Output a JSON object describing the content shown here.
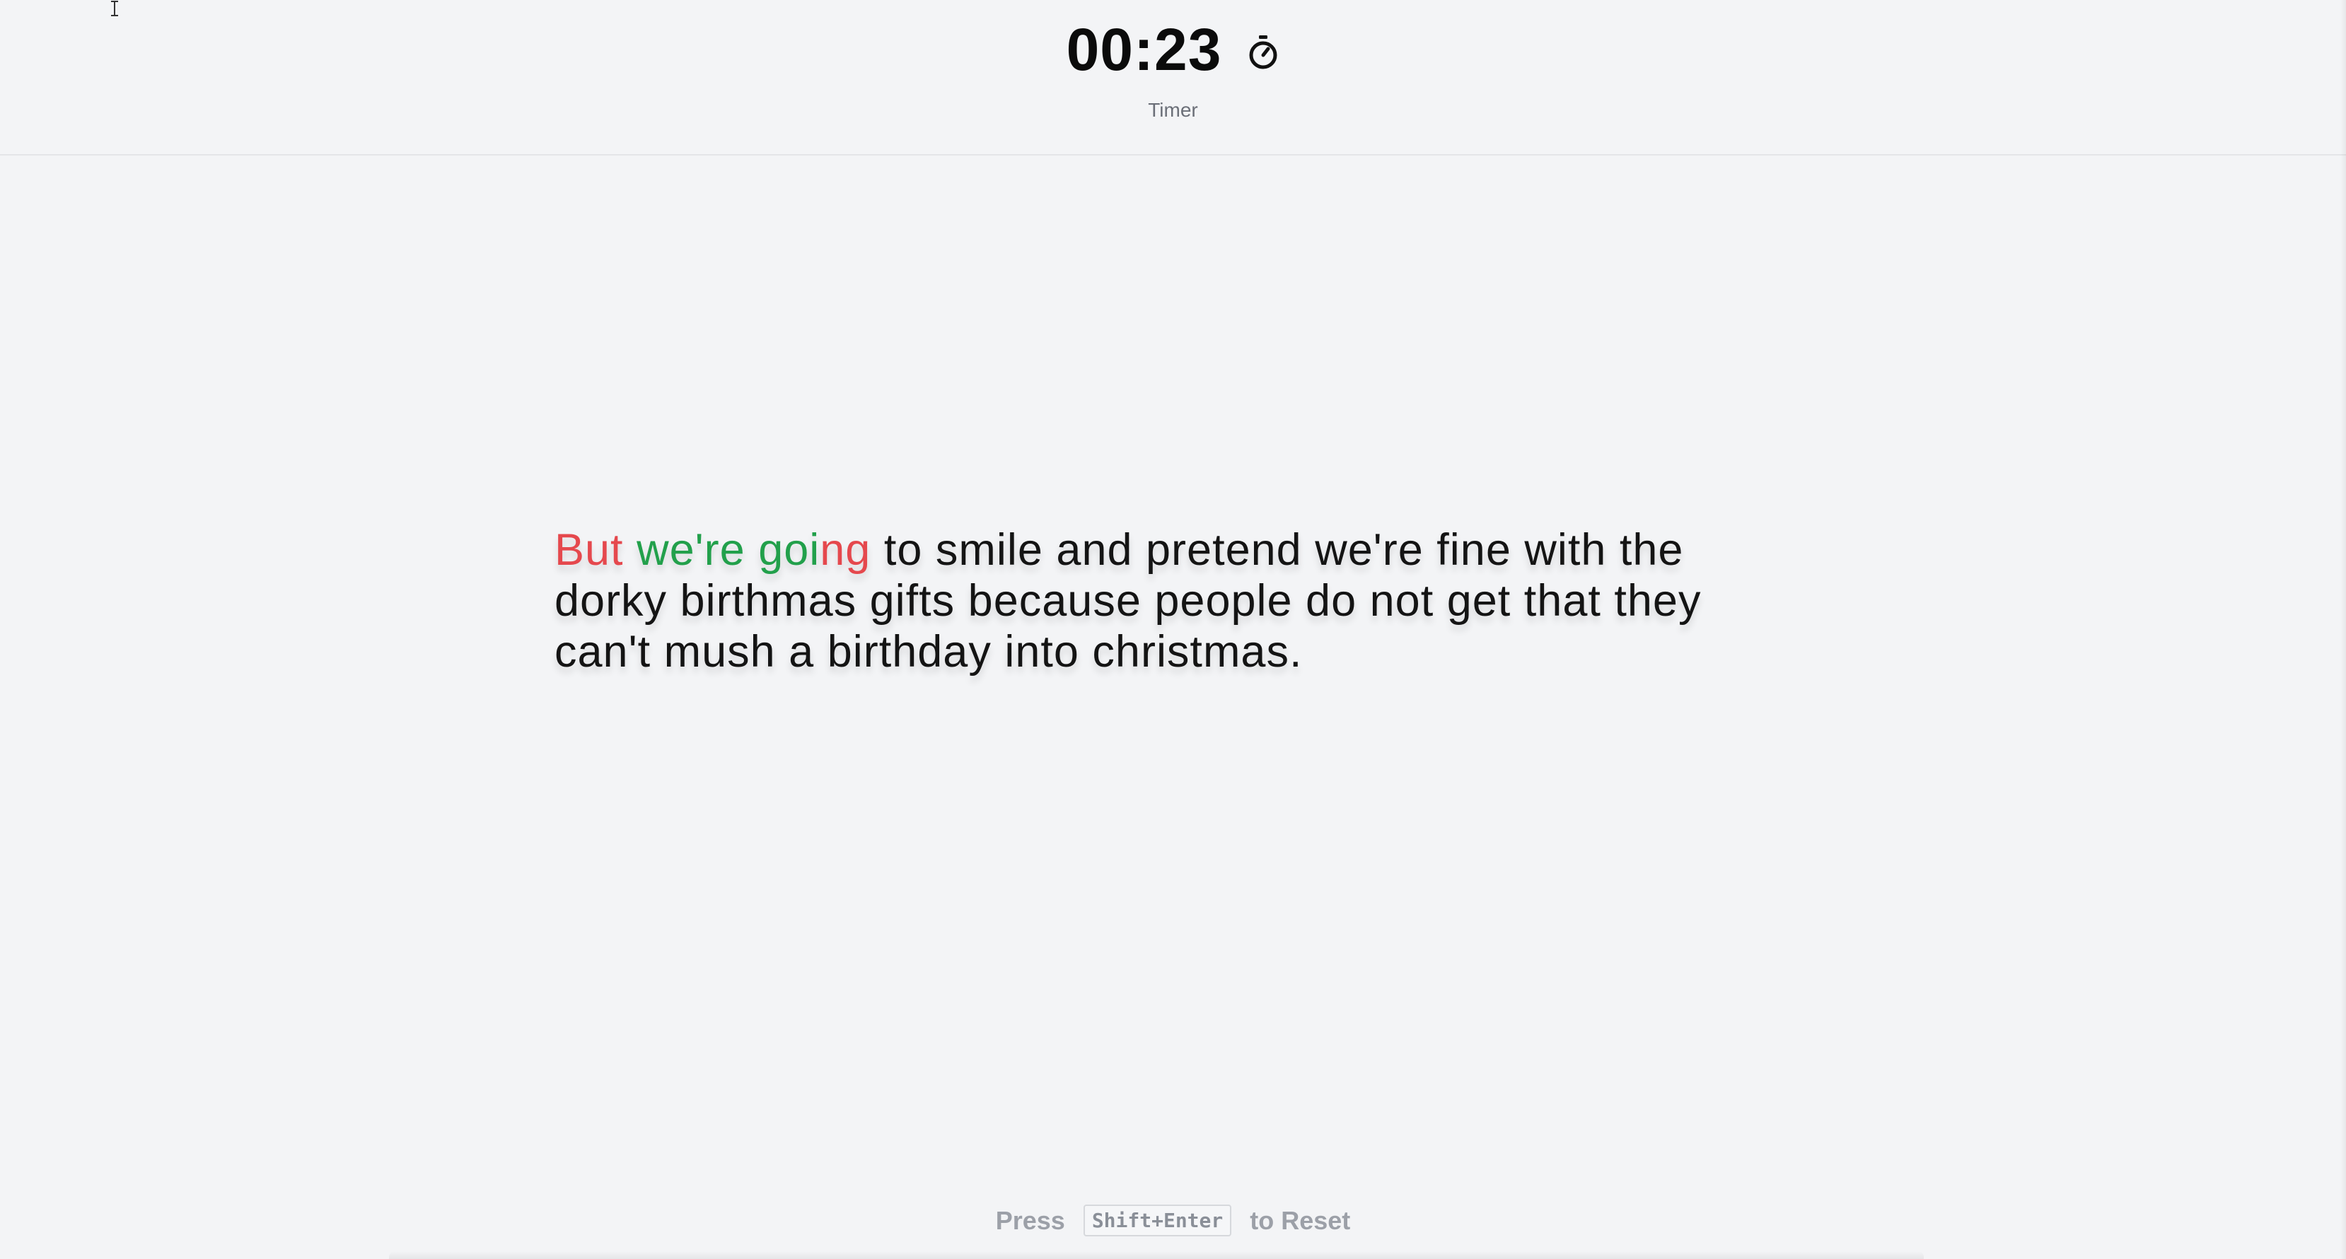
{
  "header": {
    "timer_value": "00:23",
    "timer_label": "Timer",
    "timer_icon": "stopwatch-icon"
  },
  "passage": {
    "segments": [
      {
        "text": "But",
        "state": "wrong"
      },
      {
        "text": " ",
        "state": "pending"
      },
      {
        "text": "we're",
        "state": "correct"
      },
      {
        "text": " ",
        "state": "pending"
      },
      {
        "text": "goi",
        "state": "correct"
      },
      {
        "text": "ng",
        "state": "wrong"
      },
      {
        "text": " to smile and pretend we're fine with the dorky birthmas gifts because people do not get that they can't mush a birthday into christmas.",
        "state": "pending"
      }
    ],
    "colors": {
      "correct": "#22a04b",
      "wrong": "#e5484d",
      "pending": "#141414"
    }
  },
  "footer": {
    "press_label": "Press",
    "shortcut": "Shift+Enter",
    "action_label": "to Reset"
  }
}
